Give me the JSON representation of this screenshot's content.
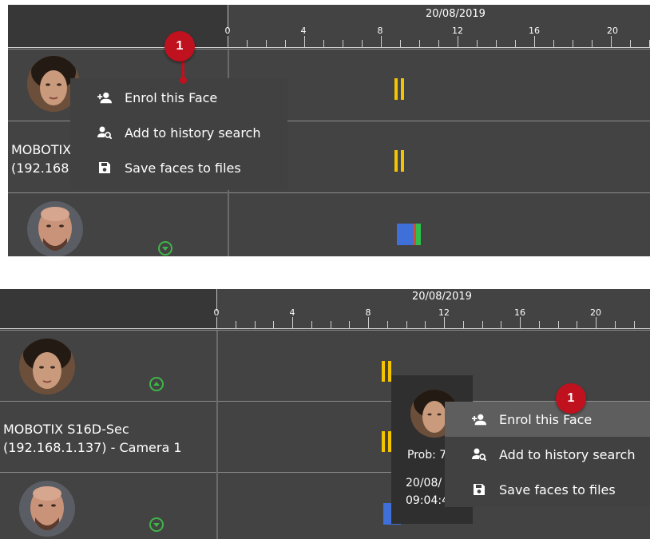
{
  "timeline": {
    "date": "20/08/2019",
    "tick_labels_top": [
      "0",
      "4",
      "8",
      "12",
      "16",
      "20"
    ],
    "tick_labels_bottom": [
      "0",
      "4",
      "8",
      "12",
      "16",
      "20"
    ]
  },
  "camera": {
    "label_line1_full": "MOBOTIX S16D-Sec",
    "label_line2_full": "(192.168.1.137) - Camera 1",
    "label_line1_clipped": "MOBOTIX",
    "label_line2_clipped": "(192.168."
  },
  "context_menu": {
    "items": [
      {
        "label": "Enrol this Face",
        "icon": "person-add-icon"
      },
      {
        "label": "Add to history search",
        "icon": "person-search-icon"
      },
      {
        "label": "Save faces to files",
        "icon": "save-icon"
      }
    ]
  },
  "detection_popup": {
    "prob_text": "Prob: 7",
    "date_text": "20/08/",
    "time_text": "09:04:4"
  },
  "callout": {
    "number": "1"
  },
  "colors": {
    "panel_bg": "#434343",
    "marker_yellow": "#f5c400",
    "callout_red": "#c0121e",
    "expand_green": "#3fb548",
    "bar_blue": "#3f6fd8",
    "bar_green": "#2fbf4a",
    "bar_red": "#d14a3a"
  }
}
